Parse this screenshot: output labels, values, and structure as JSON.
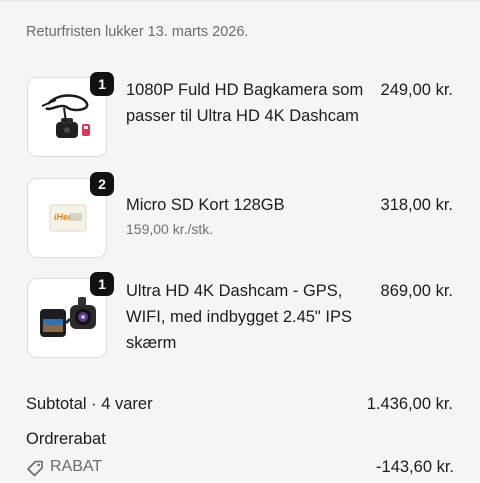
{
  "return_note": "Returfristen lukker 13. marts 2026.",
  "items": [
    {
      "quantity": "1",
      "title": "1080P Fuld HD Bagkamera som passer til Ultra HD 4K Dashcam",
      "price": "249,00 kr.",
      "image_icon": "rear-camera-cable-icon"
    },
    {
      "quantity": "2",
      "title": "Micro SD Kort 128GB",
      "unit_price": "159,00 kr./stk.",
      "price": "318,00 kr.",
      "image_icon": "sd-card-icon",
      "card_brand": "iHero"
    },
    {
      "quantity": "1",
      "title": "Ultra HD 4K Dashcam - GPS, WIFI, med indbygget 2.45\" IPS skærm",
      "price": "869,00 kr.",
      "image_icon": "dashcam-icon"
    }
  ],
  "summary": {
    "subtotal_label": "Subtotal · 4 varer",
    "subtotal_value": "1.436,00 kr.",
    "order_discount_label": "Ordrerabat",
    "discount_code": "RABAT",
    "discount_value": "-143,60 kr."
  }
}
